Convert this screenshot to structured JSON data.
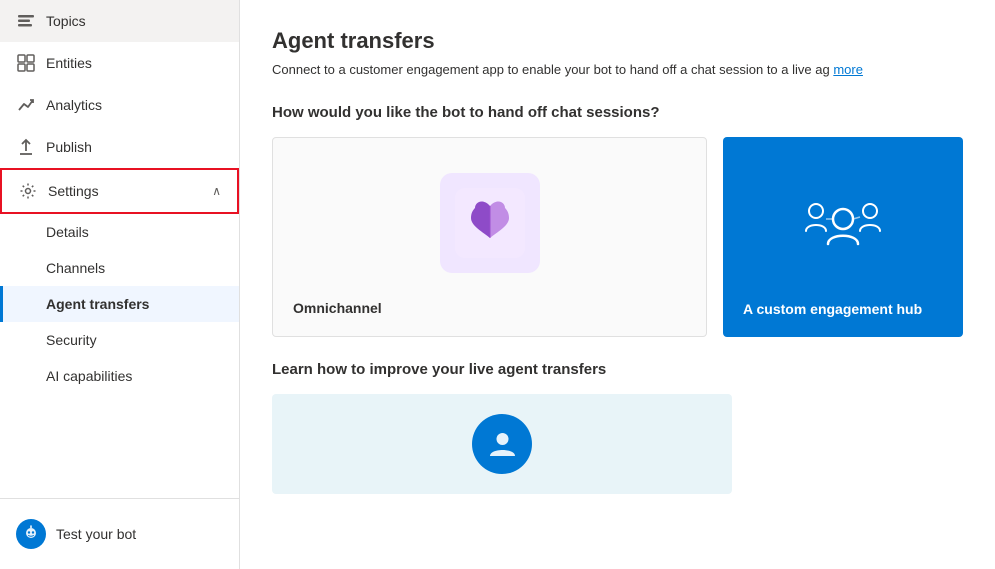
{
  "sidebar": {
    "items": [
      {
        "id": "topics",
        "label": "Topics",
        "icon": "💬",
        "active": false
      },
      {
        "id": "entities",
        "label": "Entities",
        "icon": "⊞",
        "active": false
      },
      {
        "id": "analytics",
        "label": "Analytics",
        "icon": "↗",
        "active": false
      },
      {
        "id": "publish",
        "label": "Publish",
        "icon": "↑",
        "active": false
      },
      {
        "id": "settings",
        "label": "Settings",
        "icon": "⚙",
        "active": true,
        "expanded": true,
        "chevron": "∧"
      }
    ],
    "sub_items": [
      {
        "id": "details",
        "label": "Details",
        "active": false
      },
      {
        "id": "channels",
        "label": "Channels",
        "active": false
      },
      {
        "id": "agent-transfers",
        "label": "Agent transfers",
        "active": true
      },
      {
        "id": "security",
        "label": "Security",
        "active": false
      },
      {
        "id": "ai-capabilities",
        "label": "AI capabilities",
        "active": false
      }
    ],
    "bottom": {
      "icon": "🤖",
      "label": "Test your bot"
    }
  },
  "main": {
    "title": "Agent transfers",
    "description": "Connect to a customer engagement app to enable your bot to hand off a chat session to a live ag",
    "learn_more": "more",
    "handoff_question": "How would you like the bot to hand off chat sessions?",
    "cards": [
      {
        "id": "omnichannel",
        "title": "Omnichannel"
      },
      {
        "id": "custom-hub",
        "title": "A custom engagement hub"
      }
    ],
    "learn_section_title": "Learn how to improve your live agent transfers"
  }
}
